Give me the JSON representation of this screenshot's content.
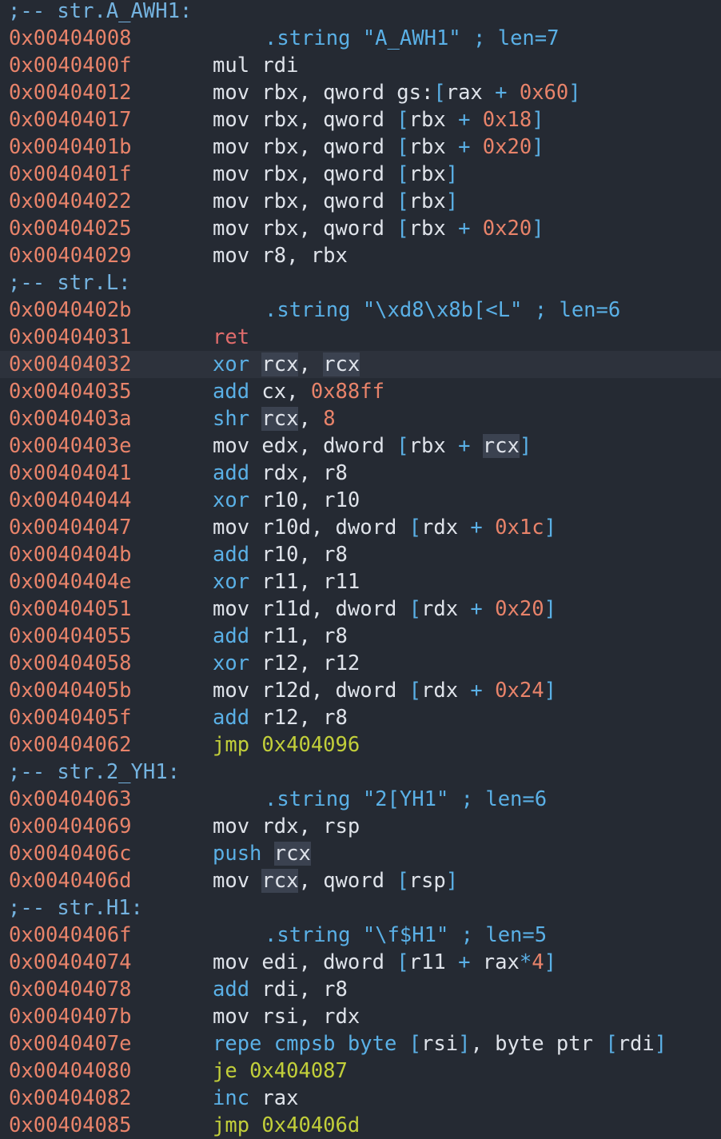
{
  "colors": {
    "background": "#252a33",
    "address": "#e8836a",
    "flag": "#74b3e0",
    "mnemonic_common": "#5ab0e6",
    "mnemonic_ret": "#e06c6c",
    "mnemonic_jump": "#c2cf3a",
    "operand": "#dfe3ea",
    "number": "#e8836a",
    "operator": "#5ab0e6",
    "selection_highlight": "#3b4250",
    "current_line": "#2d323c"
  },
  "lines": [
    {
      "kind": "flag",
      "text": ";-- str.A_AWH1:"
    },
    {
      "kind": "string",
      "addr": "0x00404008",
      "tokens": [
        {
          "t": ".string ",
          "c": "blue"
        },
        {
          "t": "\"A_AWH1\"",
          "c": "blue"
        },
        {
          "t": " ; len=7",
          "c": "blue"
        }
      ]
    },
    {
      "kind": "instr",
      "addr": "0x0040400f",
      "tokens": [
        {
          "t": "mul",
          "c": "white"
        },
        {
          "t": " rdi",
          "c": "white"
        }
      ]
    },
    {
      "kind": "instr",
      "addr": "0x00404012",
      "tokens": [
        {
          "t": "mov",
          "c": "white"
        },
        {
          "t": " rbx, qword gs:",
          "c": "white"
        },
        {
          "t": "[",
          "c": "blue"
        },
        {
          "t": "rax",
          "c": "white"
        },
        {
          "t": " + ",
          "c": "blue"
        },
        {
          "t": "0x60",
          "c": "num"
        },
        {
          "t": "]",
          "c": "blue"
        }
      ]
    },
    {
      "kind": "instr",
      "addr": "0x00404017",
      "tokens": [
        {
          "t": "mov",
          "c": "white"
        },
        {
          "t": " rbx, qword ",
          "c": "white"
        },
        {
          "t": "[",
          "c": "blue"
        },
        {
          "t": "rbx",
          "c": "white"
        },
        {
          "t": " + ",
          "c": "blue"
        },
        {
          "t": "0x18",
          "c": "num"
        },
        {
          "t": "]",
          "c": "blue"
        }
      ]
    },
    {
      "kind": "instr",
      "addr": "0x0040401b",
      "tokens": [
        {
          "t": "mov",
          "c": "white"
        },
        {
          "t": " rbx, qword ",
          "c": "white"
        },
        {
          "t": "[",
          "c": "blue"
        },
        {
          "t": "rbx",
          "c": "white"
        },
        {
          "t": " + ",
          "c": "blue"
        },
        {
          "t": "0x20",
          "c": "num"
        },
        {
          "t": "]",
          "c": "blue"
        }
      ]
    },
    {
      "kind": "instr",
      "addr": "0x0040401f",
      "tokens": [
        {
          "t": "mov",
          "c": "white"
        },
        {
          "t": " rbx, qword ",
          "c": "white"
        },
        {
          "t": "[",
          "c": "blue"
        },
        {
          "t": "rbx",
          "c": "white"
        },
        {
          "t": "]",
          "c": "blue"
        }
      ]
    },
    {
      "kind": "instr",
      "addr": "0x00404022",
      "tokens": [
        {
          "t": "mov",
          "c": "white"
        },
        {
          "t": " rbx, qword ",
          "c": "white"
        },
        {
          "t": "[",
          "c": "blue"
        },
        {
          "t": "rbx",
          "c": "white"
        },
        {
          "t": "]",
          "c": "blue"
        }
      ]
    },
    {
      "kind": "instr",
      "addr": "0x00404025",
      "tokens": [
        {
          "t": "mov",
          "c": "white"
        },
        {
          "t": " rbx, qword ",
          "c": "white"
        },
        {
          "t": "[",
          "c": "blue"
        },
        {
          "t": "rbx",
          "c": "white"
        },
        {
          "t": " + ",
          "c": "blue"
        },
        {
          "t": "0x20",
          "c": "num"
        },
        {
          "t": "]",
          "c": "blue"
        }
      ]
    },
    {
      "kind": "instr",
      "addr": "0x00404029",
      "tokens": [
        {
          "t": "mov",
          "c": "white"
        },
        {
          "t": " r8, rbx",
          "c": "white"
        }
      ]
    },
    {
      "kind": "flag",
      "text": ";-- str.L:"
    },
    {
      "kind": "string",
      "addr": "0x0040402b",
      "tokens": [
        {
          "t": ".string ",
          "c": "blue"
        },
        {
          "t": "\"\\xd8\\x8b[<L\"",
          "c": "blue"
        },
        {
          "t": " ; len=6",
          "c": "blue"
        }
      ]
    },
    {
      "kind": "instr",
      "addr": "0x00404031",
      "tokens": [
        {
          "t": "ret",
          "c": "red"
        }
      ]
    },
    {
      "kind": "instr",
      "addr": "0x00404032",
      "current": true,
      "tokens": [
        {
          "t": "xor",
          "c": "blue"
        },
        {
          "t": " ",
          "c": "white"
        },
        {
          "t": "rcx",
          "c": "white",
          "hl": true
        },
        {
          "t": ", ",
          "c": "white"
        },
        {
          "t": "rcx",
          "c": "white",
          "hl": true
        }
      ]
    },
    {
      "kind": "instr",
      "addr": "0x00404035",
      "tokens": [
        {
          "t": "add",
          "c": "blue"
        },
        {
          "t": " cx, ",
          "c": "white"
        },
        {
          "t": "0x88ff",
          "c": "num"
        }
      ]
    },
    {
      "kind": "instr",
      "addr": "0x0040403a",
      "tokens": [
        {
          "t": "shr",
          "c": "blue"
        },
        {
          "t": " ",
          "c": "white"
        },
        {
          "t": "rcx",
          "c": "white",
          "hl": true
        },
        {
          "t": ", ",
          "c": "white"
        },
        {
          "t": "8",
          "c": "num"
        }
      ]
    },
    {
      "kind": "instr",
      "addr": "0x0040403e",
      "tokens": [
        {
          "t": "mov",
          "c": "white"
        },
        {
          "t": " edx, dword ",
          "c": "white"
        },
        {
          "t": "[",
          "c": "blue"
        },
        {
          "t": "rbx",
          "c": "white"
        },
        {
          "t": " + ",
          "c": "blue"
        },
        {
          "t": "rcx",
          "c": "white",
          "hl": true
        },
        {
          "t": "]",
          "c": "blue"
        }
      ]
    },
    {
      "kind": "instr",
      "addr": "0x00404041",
      "tokens": [
        {
          "t": "add",
          "c": "blue"
        },
        {
          "t": " rdx, r8",
          "c": "white"
        }
      ]
    },
    {
      "kind": "instr",
      "addr": "0x00404044",
      "tokens": [
        {
          "t": "xor",
          "c": "blue"
        },
        {
          "t": " r10, r10",
          "c": "white"
        }
      ]
    },
    {
      "kind": "instr",
      "addr": "0x00404047",
      "tokens": [
        {
          "t": "mov",
          "c": "white"
        },
        {
          "t": " r10d, dword ",
          "c": "white"
        },
        {
          "t": "[",
          "c": "blue"
        },
        {
          "t": "rdx",
          "c": "white"
        },
        {
          "t": " + ",
          "c": "blue"
        },
        {
          "t": "0x1c",
          "c": "num"
        },
        {
          "t": "]",
          "c": "blue"
        }
      ]
    },
    {
      "kind": "instr",
      "addr": "0x0040404b",
      "tokens": [
        {
          "t": "add",
          "c": "blue"
        },
        {
          "t": " r10, r8",
          "c": "white"
        }
      ]
    },
    {
      "kind": "instr",
      "addr": "0x0040404e",
      "tokens": [
        {
          "t": "xor",
          "c": "blue"
        },
        {
          "t": " r11, r11",
          "c": "white"
        }
      ]
    },
    {
      "kind": "instr",
      "addr": "0x00404051",
      "tokens": [
        {
          "t": "mov",
          "c": "white"
        },
        {
          "t": " r11d, dword ",
          "c": "white"
        },
        {
          "t": "[",
          "c": "blue"
        },
        {
          "t": "rdx",
          "c": "white"
        },
        {
          "t": " + ",
          "c": "blue"
        },
        {
          "t": "0x20",
          "c": "num"
        },
        {
          "t": "]",
          "c": "blue"
        }
      ]
    },
    {
      "kind": "instr",
      "addr": "0x00404055",
      "tokens": [
        {
          "t": "add",
          "c": "blue"
        },
        {
          "t": " r11, r8",
          "c": "white"
        }
      ]
    },
    {
      "kind": "instr",
      "addr": "0x00404058",
      "tokens": [
        {
          "t": "xor",
          "c": "blue"
        },
        {
          "t": " r12, r12",
          "c": "white"
        }
      ]
    },
    {
      "kind": "instr",
      "addr": "0x0040405b",
      "tokens": [
        {
          "t": "mov",
          "c": "white"
        },
        {
          "t": " r12d, dword ",
          "c": "white"
        },
        {
          "t": "[",
          "c": "blue"
        },
        {
          "t": "rdx",
          "c": "white"
        },
        {
          "t": " + ",
          "c": "blue"
        },
        {
          "t": "0x24",
          "c": "num"
        },
        {
          "t": "]",
          "c": "blue"
        }
      ]
    },
    {
      "kind": "instr",
      "addr": "0x0040405f",
      "tokens": [
        {
          "t": "add",
          "c": "blue"
        },
        {
          "t": " r12, r8",
          "c": "white"
        }
      ]
    },
    {
      "kind": "instr",
      "addr": "0x00404062",
      "tokens": [
        {
          "t": "jmp",
          "c": "green"
        },
        {
          "t": " 0x404096",
          "c": "green"
        }
      ]
    },
    {
      "kind": "flag",
      "text": ";-- str.2_YH1:"
    },
    {
      "kind": "string",
      "addr": "0x00404063",
      "tokens": [
        {
          "t": ".string ",
          "c": "blue"
        },
        {
          "t": "\"2[YH1\"",
          "c": "blue"
        },
        {
          "t": " ; len=6",
          "c": "blue"
        }
      ]
    },
    {
      "kind": "instr",
      "addr": "0x00404069",
      "tokens": [
        {
          "t": "mov",
          "c": "white"
        },
        {
          "t": " rdx, rsp",
          "c": "white"
        }
      ]
    },
    {
      "kind": "instr",
      "addr": "0x0040406c",
      "tokens": [
        {
          "t": "push",
          "c": "blue"
        },
        {
          "t": " ",
          "c": "white"
        },
        {
          "t": "rcx",
          "c": "white",
          "hl": true
        }
      ]
    },
    {
      "kind": "instr",
      "addr": "0x0040406d",
      "tokens": [
        {
          "t": "mov",
          "c": "white"
        },
        {
          "t": " ",
          "c": "white"
        },
        {
          "t": "rcx",
          "c": "white",
          "hl": true
        },
        {
          "t": ", qword ",
          "c": "white"
        },
        {
          "t": "[",
          "c": "blue"
        },
        {
          "t": "rsp",
          "c": "white"
        },
        {
          "t": "]",
          "c": "blue"
        }
      ]
    },
    {
      "kind": "flag",
      "text": ";-- str.H1:"
    },
    {
      "kind": "string",
      "addr": "0x0040406f",
      "tokens": [
        {
          "t": ".string ",
          "c": "blue"
        },
        {
          "t": "\"\\f$H1\"",
          "c": "blue"
        },
        {
          "t": " ; len=5",
          "c": "blue"
        }
      ]
    },
    {
      "kind": "instr",
      "addr": "0x00404074",
      "tokens": [
        {
          "t": "mov",
          "c": "white"
        },
        {
          "t": " edi, dword ",
          "c": "white"
        },
        {
          "t": "[",
          "c": "blue"
        },
        {
          "t": "r11",
          "c": "white"
        },
        {
          "t": " + ",
          "c": "blue"
        },
        {
          "t": "rax",
          "c": "white"
        },
        {
          "t": "*",
          "c": "blue"
        },
        {
          "t": "4",
          "c": "num"
        },
        {
          "t": "]",
          "c": "blue"
        }
      ]
    },
    {
      "kind": "instr",
      "addr": "0x00404078",
      "tokens": [
        {
          "t": "add",
          "c": "blue"
        },
        {
          "t": " rdi, r8",
          "c": "white"
        }
      ]
    },
    {
      "kind": "instr",
      "addr": "0x0040407b",
      "tokens": [
        {
          "t": "mov",
          "c": "white"
        },
        {
          "t": " rsi, rdx",
          "c": "white"
        }
      ]
    },
    {
      "kind": "instr",
      "addr": "0x0040407e",
      "tokens": [
        {
          "t": "repe cmpsb",
          "c": "blue"
        },
        {
          "t": " ",
          "c": "white"
        },
        {
          "t": "byte ",
          "c": "blue"
        },
        {
          "t": "[",
          "c": "blue"
        },
        {
          "t": "rsi",
          "c": "white"
        },
        {
          "t": "]",
          "c": "blue"
        },
        {
          "t": ", byte ptr ",
          "c": "white"
        },
        {
          "t": "[",
          "c": "blue"
        },
        {
          "t": "rdi",
          "c": "white"
        },
        {
          "t": "]",
          "c": "blue"
        }
      ]
    },
    {
      "kind": "instr",
      "addr": "0x00404080",
      "tokens": [
        {
          "t": "je",
          "c": "green"
        },
        {
          "t": " 0x404087",
          "c": "green"
        }
      ]
    },
    {
      "kind": "instr",
      "addr": "0x00404082",
      "tokens": [
        {
          "t": "inc",
          "c": "blue"
        },
        {
          "t": " rax",
          "c": "white"
        }
      ]
    },
    {
      "kind": "instr",
      "addr": "0x00404085",
      "tokens": [
        {
          "t": "jmp",
          "c": "green"
        },
        {
          "t": " 0x40406d",
          "c": "green"
        }
      ]
    }
  ]
}
